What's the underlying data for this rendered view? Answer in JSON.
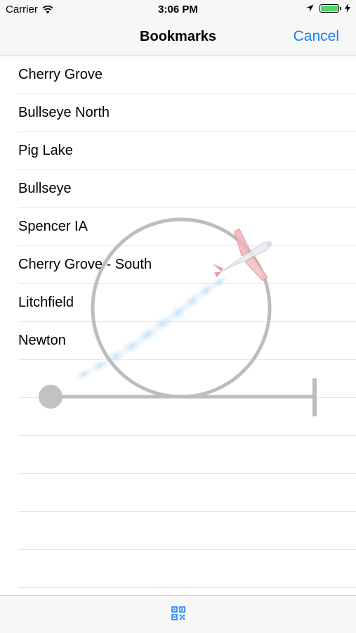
{
  "status_bar": {
    "carrier": "Carrier",
    "time": "3:06 PM",
    "icons": [
      "wifi-icon",
      "location-arrow-icon",
      "battery-icon",
      "charging-bolt-icon"
    ],
    "battery_color": "#4cd964"
  },
  "nav": {
    "title": "Bookmarks",
    "cancel_label": "Cancel",
    "accent_color": "#1a7ef7"
  },
  "bookmarks": [
    "Cherry Grove",
    "Bullseye North",
    "Pig Lake",
    "Bullseye",
    "Spencer IA",
    "Cherry Grove - South",
    "Litchfield",
    "Newton"
  ],
  "overlay": {
    "icons": [
      "loop-circle-icon",
      "airplane-icon",
      "smoke-trail-icon",
      "progress-track-icon"
    ]
  },
  "toolbar": {
    "icons": [
      "qr-code-icon"
    ]
  }
}
